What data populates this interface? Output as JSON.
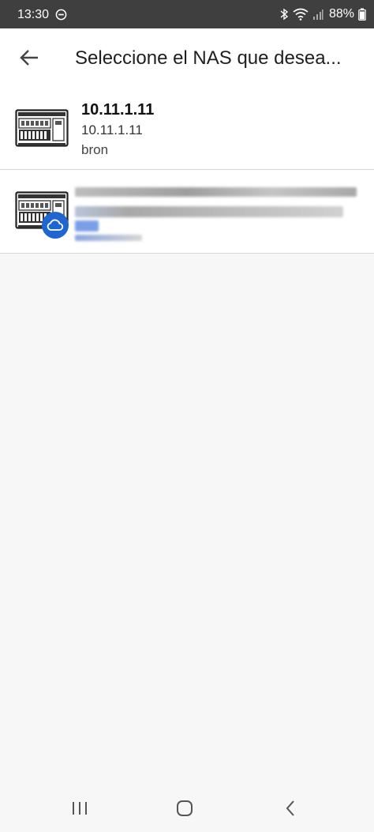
{
  "status_bar": {
    "time": "13:30",
    "battery": "88%",
    "icons": [
      "dnd-icon",
      "bluetooth-icon",
      "wifi-icon",
      "signal-icon",
      "battery-icon"
    ]
  },
  "app_bar": {
    "back_icon": "arrow-back-icon",
    "title": "Seleccione el NAS que desea..."
  },
  "devices": [
    {
      "name": "10.11.1.11",
      "address": "10.11.1.11",
      "user": "bron",
      "icon": "nas-icon"
    },
    {
      "name": "",
      "address": "",
      "user": "",
      "icon": "nas-icon",
      "badge_icon": "cloud-icon",
      "obscured": true
    }
  ],
  "nav_bar": {
    "icons": [
      "recent-apps-icon",
      "home-icon",
      "back-icon"
    ]
  },
  "colors": {
    "status_bar": "#3f3f3f",
    "background": "#f7f7f7",
    "badge": "#1f66d1"
  }
}
